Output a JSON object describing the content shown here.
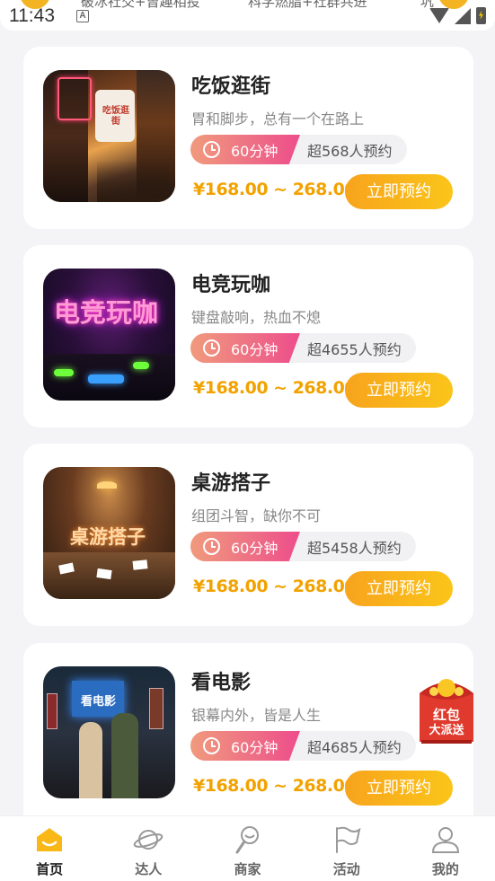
{
  "status_bar": {
    "time": "11:43",
    "notif_glyph": "A",
    "top_fragments": [
      "破冰社交+曾趣相投",
      "科学燃脂+社群共进",
      "巩"
    ]
  },
  "cards": [
    {
      "title": "吃饭逛街",
      "subtitle": "胃和脚步，总有一个在路上",
      "duration": "60分钟",
      "bookings": "超568人预约",
      "price": "¥168.00 ~ 268.00",
      "button": "立即预约",
      "thumb_sign": "吃饭逛街",
      "thumb_icon": "street-scene-image"
    },
    {
      "title": "电竞玩咖",
      "subtitle": "键盘敲响，热血不熄",
      "duration": "60分钟",
      "bookings": "超4655人预约",
      "price": "¥168.00 ~ 268.00",
      "button": "立即预约",
      "thumb_sign": "电竞玩咖",
      "thumb_icon": "esports-bar-image"
    },
    {
      "title": "桌游搭子",
      "subtitle": "组团斗智，缺你不可",
      "duration": "60分钟",
      "bookings": "超5458人预约",
      "price": "¥168.00 ~ 268.00",
      "button": "立即预约",
      "thumb_sign": "桌游搭子",
      "thumb_icon": "board-game-image"
    },
    {
      "title": "看电影",
      "subtitle": "银幕内外，皆是人生",
      "duration": "60分钟",
      "bookings": "超4685人预约",
      "price": "¥168.00 ~ 268.00",
      "button": "立即预约",
      "thumb_sign": "看电影",
      "thumb_icon": "movie-couple-image"
    }
  ],
  "redpack": {
    "line1": "红包",
    "line2": "大派送"
  },
  "tabbar": {
    "items": [
      {
        "label": "首页",
        "icon": "home-icon",
        "active": true
      },
      {
        "label": "达人",
        "icon": "planet-icon",
        "active": false
      },
      {
        "label": "商家",
        "icon": "shop-icon",
        "active": false
      },
      {
        "label": "活动",
        "icon": "flag-icon",
        "active": false
      },
      {
        "label": "我的",
        "icon": "user-icon",
        "active": false
      }
    ]
  },
  "colors": {
    "accent": "#f9b816",
    "price": "#f2a200",
    "duration_gradient_start": "#f09a7d",
    "duration_gradient_end": "#ee4d8a",
    "redpack": "#e52e2e"
  }
}
